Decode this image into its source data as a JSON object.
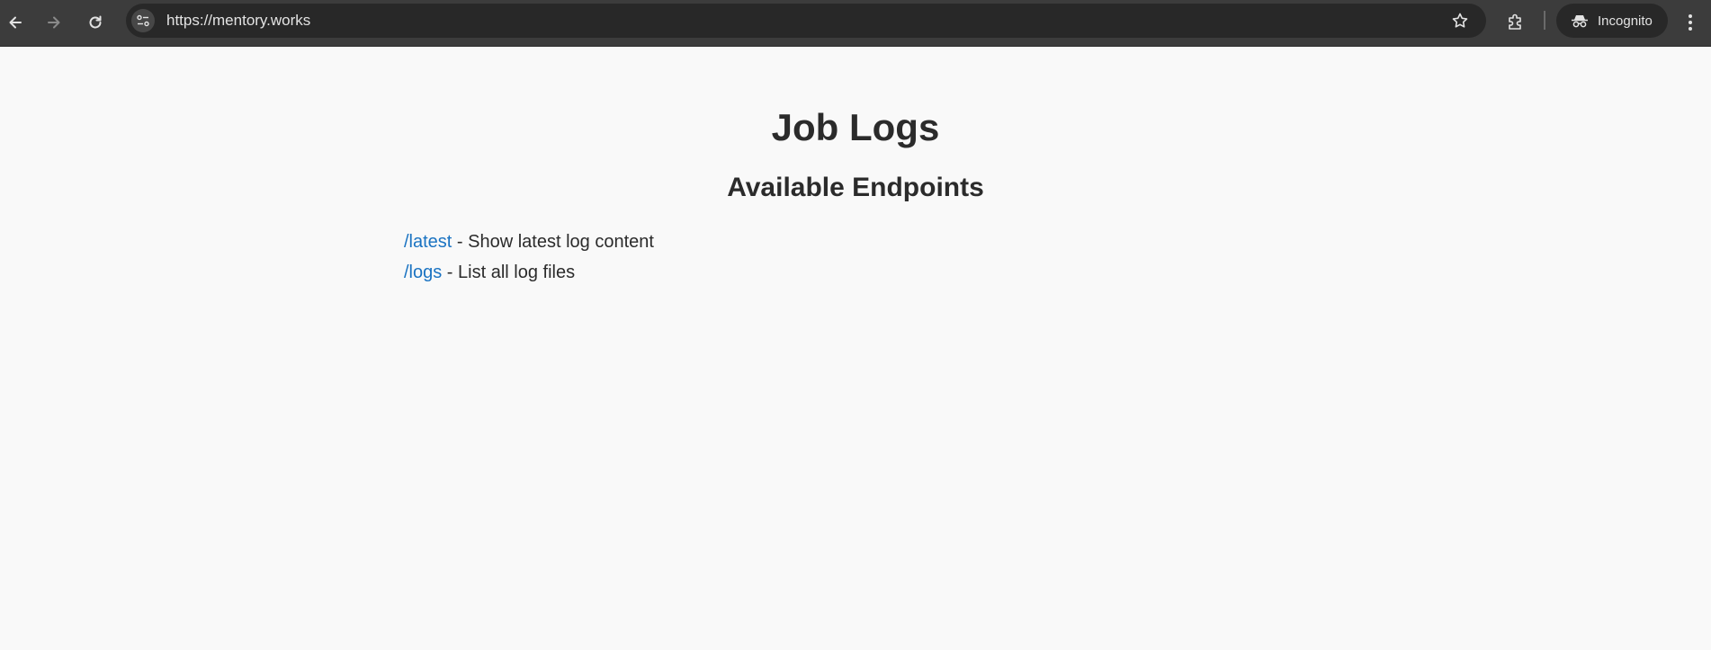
{
  "browser": {
    "url": "https://mentory.works",
    "profile_label": "Incognito",
    "icons": [
      "back-arrow-icon",
      "forward-arrow-icon",
      "reload-icon",
      "site-info-icon",
      "bookmark-star-icon",
      "extensions-icon",
      "incognito-icon",
      "more-menu-icon"
    ]
  },
  "page": {
    "title": "Job Logs",
    "subtitle": "Available Endpoints",
    "endpoints": [
      {
        "path": "/latest",
        "description": " - Show latest log content"
      },
      {
        "path": "/logs",
        "description": " - List all log files"
      }
    ]
  },
  "colors": {
    "page_background": "#f9f9f9",
    "link": "#1a73c2",
    "text": "#2b2b2b",
    "toolbar": "#3c3c3c",
    "omnibox": "#282828"
  }
}
